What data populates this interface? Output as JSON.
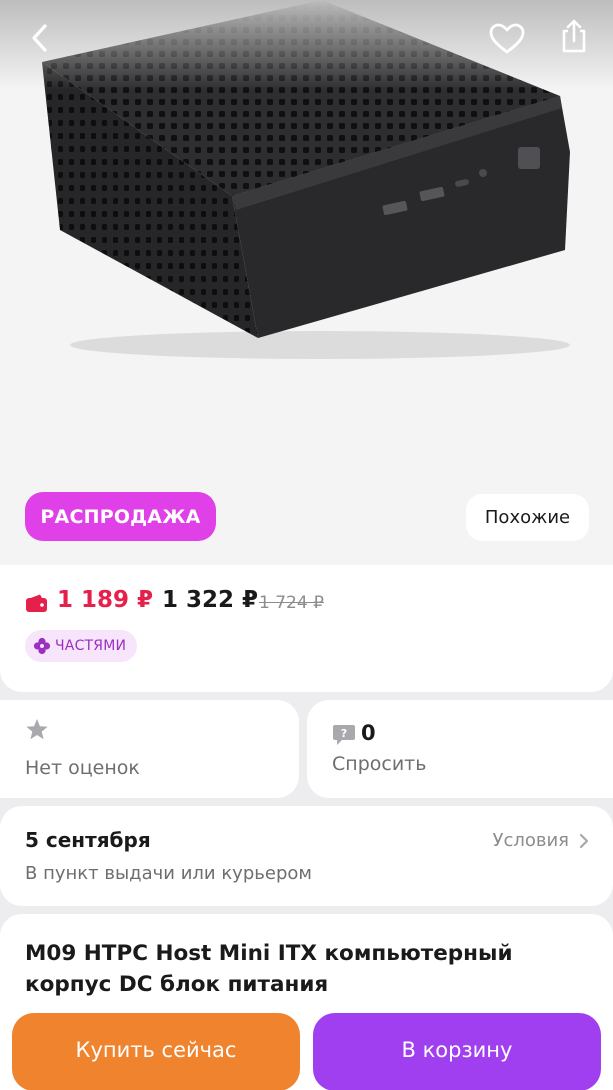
{
  "header": {
    "back_icon": "chevron-left-icon",
    "favorite_icon": "heart-icon",
    "share_icon": "share-icon"
  },
  "gallery": {
    "sale_badge": "РАСПРОДАЖА",
    "similar_button": "Похожие"
  },
  "price": {
    "card_price": "1 189 ₽",
    "regular_price": "1 322 ₽",
    "old_price": "1 724 ₽",
    "installments_label": "ЧАСТЯМИ"
  },
  "rating": {
    "text": "Нет оценок"
  },
  "questions": {
    "count": "0",
    "ask_label": "Спросить"
  },
  "delivery": {
    "date": "5 сентября",
    "subtitle": "В пункт выдачи или курьером",
    "conditions_label": "Условия"
  },
  "product": {
    "title": "M09 HTPC Host Mini ITX компьютерный корпус DC блок питания"
  },
  "actions": {
    "buy_now": "Купить сейчас",
    "add_to_cart": "В корзину"
  },
  "colors": {
    "sale_badge": "#e040e8",
    "card_price": "#e5204a",
    "buy_now": "#f0832d",
    "add_to_cart": "#a03ff0"
  }
}
